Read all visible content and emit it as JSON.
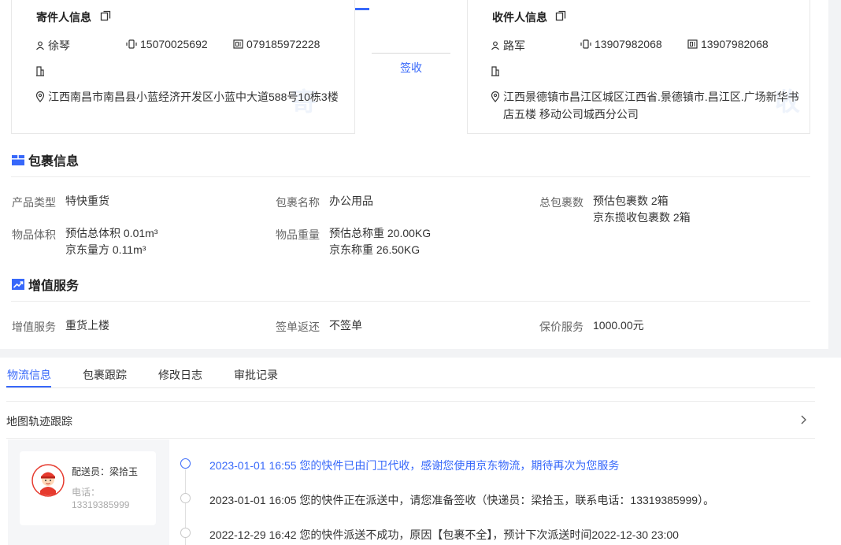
{
  "sender": {
    "title": "寄件人信息",
    "name": "徐琴",
    "mobile": "15070025692",
    "phone": "079185972228",
    "address": "江西南昌市南昌县小蓝经济开发区小蓝中大道588号10栋3楼",
    "watermark": "寄"
  },
  "receiver": {
    "title": "收件人信息",
    "name": "路军",
    "mobile": "13907982068",
    "phone": "13907982068",
    "address": "江西景德镇市昌江区城区江西省.景德镇市.昌江区.广场新华书店五楼 移动公司城西分公司",
    "watermark": "收"
  },
  "sign_status": "签收",
  "package": {
    "heading": "包裹信息",
    "product_type_label": "产品类型",
    "product_type": "特快重货",
    "package_name_label": "包裹名称",
    "package_name": "办公用品",
    "total_label": "总包裹数",
    "total_est": "预估包裹数 2箱",
    "total_jd": "京东揽收包裹数 2箱",
    "volume_label": "物品体积",
    "volume_est": "预估总体积 0.01m³",
    "volume_jd": "京东量方 0.11m³",
    "weight_label": "物品重量",
    "weight_est": "预估总称重 20.00KG",
    "weight_jd": "京东称重 26.50KG"
  },
  "value_added": {
    "heading": "增值服务",
    "service_label": "增值服务",
    "service": "重货上楼",
    "receipt_label": "签单返还",
    "receipt": "不签单",
    "insure_label": "保价服务",
    "insure": "1000.00元"
  },
  "tabs": [
    {
      "label": "物流信息",
      "active": true
    },
    {
      "label": "包裹跟踪",
      "active": false
    },
    {
      "label": "修改日志",
      "active": false
    },
    {
      "label": "审批记录",
      "active": false
    }
  ],
  "map_track_label": "地图轨迹跟踪",
  "courier": {
    "name": "配送员：梁拾玉",
    "phone_label": "电话：",
    "phone": "13319385999"
  },
  "timeline": [
    {
      "text": "2023-01-01 16:55 您的快件已由门卫代收，感谢您使用京东物流，期待再次为您服务",
      "active": true
    },
    {
      "text": "2023-01-01 16:05 您的快件正在派送中，请您准备签收（快递员：梁拾玉，联系电话：13319385999）。",
      "active": false
    },
    {
      "text": "2022-12-29 16:42 您的快件派送不成功，原因【包裹不全】，预计下次派送时间2022-12-30 23:00",
      "active": false
    }
  ],
  "colors": {
    "accent": "#3768fa",
    "band": "#f2f3f5"
  }
}
